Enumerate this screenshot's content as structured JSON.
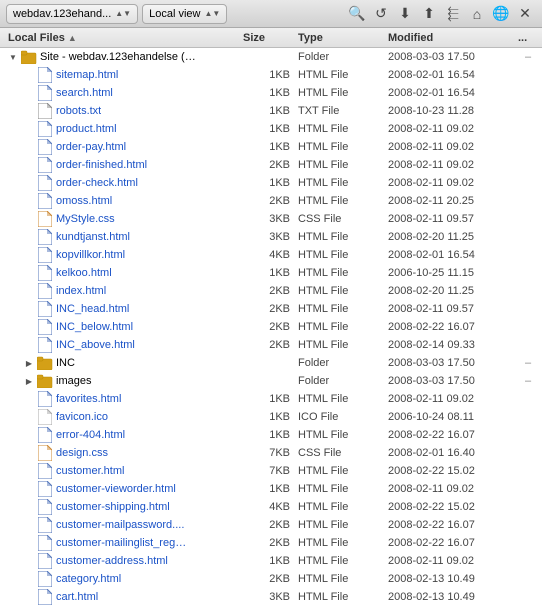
{
  "titleBar": {
    "siteDropdown": "webdav.123ehand...",
    "viewDropdown": "Local view"
  },
  "columns": {
    "name": "Local Files",
    "size": "Size",
    "type": "Type",
    "modified": "Modified",
    "extra": "..."
  },
  "files": [
    {
      "indent": 0,
      "expanded": true,
      "type": "folder",
      "name": "Site - webdav.123ehandelse (…",
      "size": "",
      "fileType": "Folder",
      "modified": "2008-03-03 17.50",
      "dash": "–"
    },
    {
      "indent": 1,
      "expanded": false,
      "type": "html",
      "name": "sitemap.html",
      "size": "1KB",
      "fileType": "HTML File",
      "modified": "2008-02-01 16.54",
      "dash": ""
    },
    {
      "indent": 1,
      "expanded": false,
      "type": "html",
      "name": "search.html",
      "size": "1KB",
      "fileType": "HTML File",
      "modified": "2008-02-01 16.54",
      "dash": ""
    },
    {
      "indent": 1,
      "expanded": false,
      "type": "txt",
      "name": "robots.txt",
      "size": "1KB",
      "fileType": "TXT File",
      "modified": "2008-10-23 11.28",
      "dash": ""
    },
    {
      "indent": 1,
      "expanded": false,
      "type": "html",
      "name": "product.html",
      "size": "1KB",
      "fileType": "HTML File",
      "modified": "2008-02-11 09.02",
      "dash": ""
    },
    {
      "indent": 1,
      "expanded": false,
      "type": "html",
      "name": "order-pay.html",
      "size": "1KB",
      "fileType": "HTML File",
      "modified": "2008-02-11 09.02",
      "dash": ""
    },
    {
      "indent": 1,
      "expanded": false,
      "type": "html",
      "name": "order-finished.html",
      "size": "2KB",
      "fileType": "HTML File",
      "modified": "2008-02-11 09.02",
      "dash": ""
    },
    {
      "indent": 1,
      "expanded": false,
      "type": "html",
      "name": "order-check.html",
      "size": "1KB",
      "fileType": "HTML File",
      "modified": "2008-02-11 09.02",
      "dash": ""
    },
    {
      "indent": 1,
      "expanded": false,
      "type": "html",
      "name": "omoss.html",
      "size": "2KB",
      "fileType": "HTML File",
      "modified": "2008-02-11 20.25",
      "dash": ""
    },
    {
      "indent": 1,
      "expanded": false,
      "type": "css",
      "name": "MyStyle.css",
      "size": "3KB",
      "fileType": "CSS File",
      "modified": "2008-02-11 09.57",
      "dash": ""
    },
    {
      "indent": 1,
      "expanded": false,
      "type": "html",
      "name": "kundtjanst.html",
      "size": "3KB",
      "fileType": "HTML File",
      "modified": "2008-02-20 11.25",
      "dash": ""
    },
    {
      "indent": 1,
      "expanded": false,
      "type": "html",
      "name": "kopvillkor.html",
      "size": "4KB",
      "fileType": "HTML File",
      "modified": "2008-02-01 16.54",
      "dash": ""
    },
    {
      "indent": 1,
      "expanded": false,
      "type": "html",
      "name": "kelkoo.html",
      "size": "1KB",
      "fileType": "HTML File",
      "modified": "2006-10-25 11.15",
      "dash": ""
    },
    {
      "indent": 1,
      "expanded": false,
      "type": "html",
      "name": "index.html",
      "size": "2KB",
      "fileType": "HTML File",
      "modified": "2008-02-20 11.25",
      "dash": ""
    },
    {
      "indent": 1,
      "expanded": false,
      "type": "html",
      "name": "INC_head.html",
      "size": "2KB",
      "fileType": "HTML File",
      "modified": "2008-02-11 09.57",
      "dash": ""
    },
    {
      "indent": 1,
      "expanded": false,
      "type": "html",
      "name": "INC_below.html",
      "size": "2KB",
      "fileType": "HTML File",
      "modified": "2008-02-22 16.07",
      "dash": ""
    },
    {
      "indent": 1,
      "expanded": false,
      "type": "html",
      "name": "INC_above.html",
      "size": "2KB",
      "fileType": "HTML File",
      "modified": "2008-02-14 09.33",
      "dash": ""
    },
    {
      "indent": 1,
      "expanded": false,
      "type": "folder",
      "name": "INC",
      "size": "",
      "fileType": "Folder",
      "modified": "2008-03-03 17.50",
      "dash": "–",
      "hasArrow": true
    },
    {
      "indent": 1,
      "expanded": false,
      "type": "folder",
      "name": "images",
      "size": "",
      "fileType": "Folder",
      "modified": "2008-03-03 17.50",
      "dash": "–",
      "hasArrow": true
    },
    {
      "indent": 1,
      "expanded": false,
      "type": "html",
      "name": "favorites.html",
      "size": "1KB",
      "fileType": "HTML File",
      "modified": "2008-02-11 09.02",
      "dash": ""
    },
    {
      "indent": 1,
      "expanded": false,
      "type": "ico",
      "name": "favicon.ico",
      "size": "1KB",
      "fileType": "ICO File",
      "modified": "2006-10-24 08.11",
      "dash": ""
    },
    {
      "indent": 1,
      "expanded": false,
      "type": "html",
      "name": "error-404.html",
      "size": "1KB",
      "fileType": "HTML File",
      "modified": "2008-02-22 16.07",
      "dash": ""
    },
    {
      "indent": 1,
      "expanded": false,
      "type": "css",
      "name": "design.css",
      "size": "7KB",
      "fileType": "CSS File",
      "modified": "2008-02-01 16.40",
      "dash": ""
    },
    {
      "indent": 1,
      "expanded": false,
      "type": "html",
      "name": "customer.html",
      "size": "7KB",
      "fileType": "HTML File",
      "modified": "2008-02-22 15.02",
      "dash": ""
    },
    {
      "indent": 1,
      "expanded": false,
      "type": "html",
      "name": "customer-vieworder.html",
      "size": "1KB",
      "fileType": "HTML File",
      "modified": "2008-02-11 09.02",
      "dash": ""
    },
    {
      "indent": 1,
      "expanded": false,
      "type": "html",
      "name": "customer-shipping.html",
      "size": "4KB",
      "fileType": "HTML File",
      "modified": "2008-02-22 15.02",
      "dash": ""
    },
    {
      "indent": 1,
      "expanded": false,
      "type": "html",
      "name": "customer-mailpassword....",
      "size": "2KB",
      "fileType": "HTML File",
      "modified": "2008-02-22 16.07",
      "dash": ""
    },
    {
      "indent": 1,
      "expanded": false,
      "type": "html",
      "name": "customer-mailinglist_reg…",
      "size": "2KB",
      "fileType": "HTML File",
      "modified": "2008-02-22 16.07",
      "dash": ""
    },
    {
      "indent": 1,
      "expanded": false,
      "type": "html",
      "name": "customer-address.html",
      "size": "1KB",
      "fileType": "HTML File",
      "modified": "2008-02-11 09.02",
      "dash": ""
    },
    {
      "indent": 1,
      "expanded": false,
      "type": "html",
      "name": "category.html",
      "size": "2KB",
      "fileType": "HTML File",
      "modified": "2008-02-13 10.49",
      "dash": ""
    },
    {
      "indent": 1,
      "expanded": false,
      "type": "html",
      "name": "cart.html",
      "size": "3KB",
      "fileType": "HTML File",
      "modified": "2008-02-13 10.49",
      "dash": ""
    }
  ],
  "icons": {
    "folder": "📁",
    "html": "📄",
    "css": "📄",
    "txt": "📄",
    "ico": "📄",
    "search": "🔍",
    "refresh": "↺",
    "home": "⌂"
  }
}
